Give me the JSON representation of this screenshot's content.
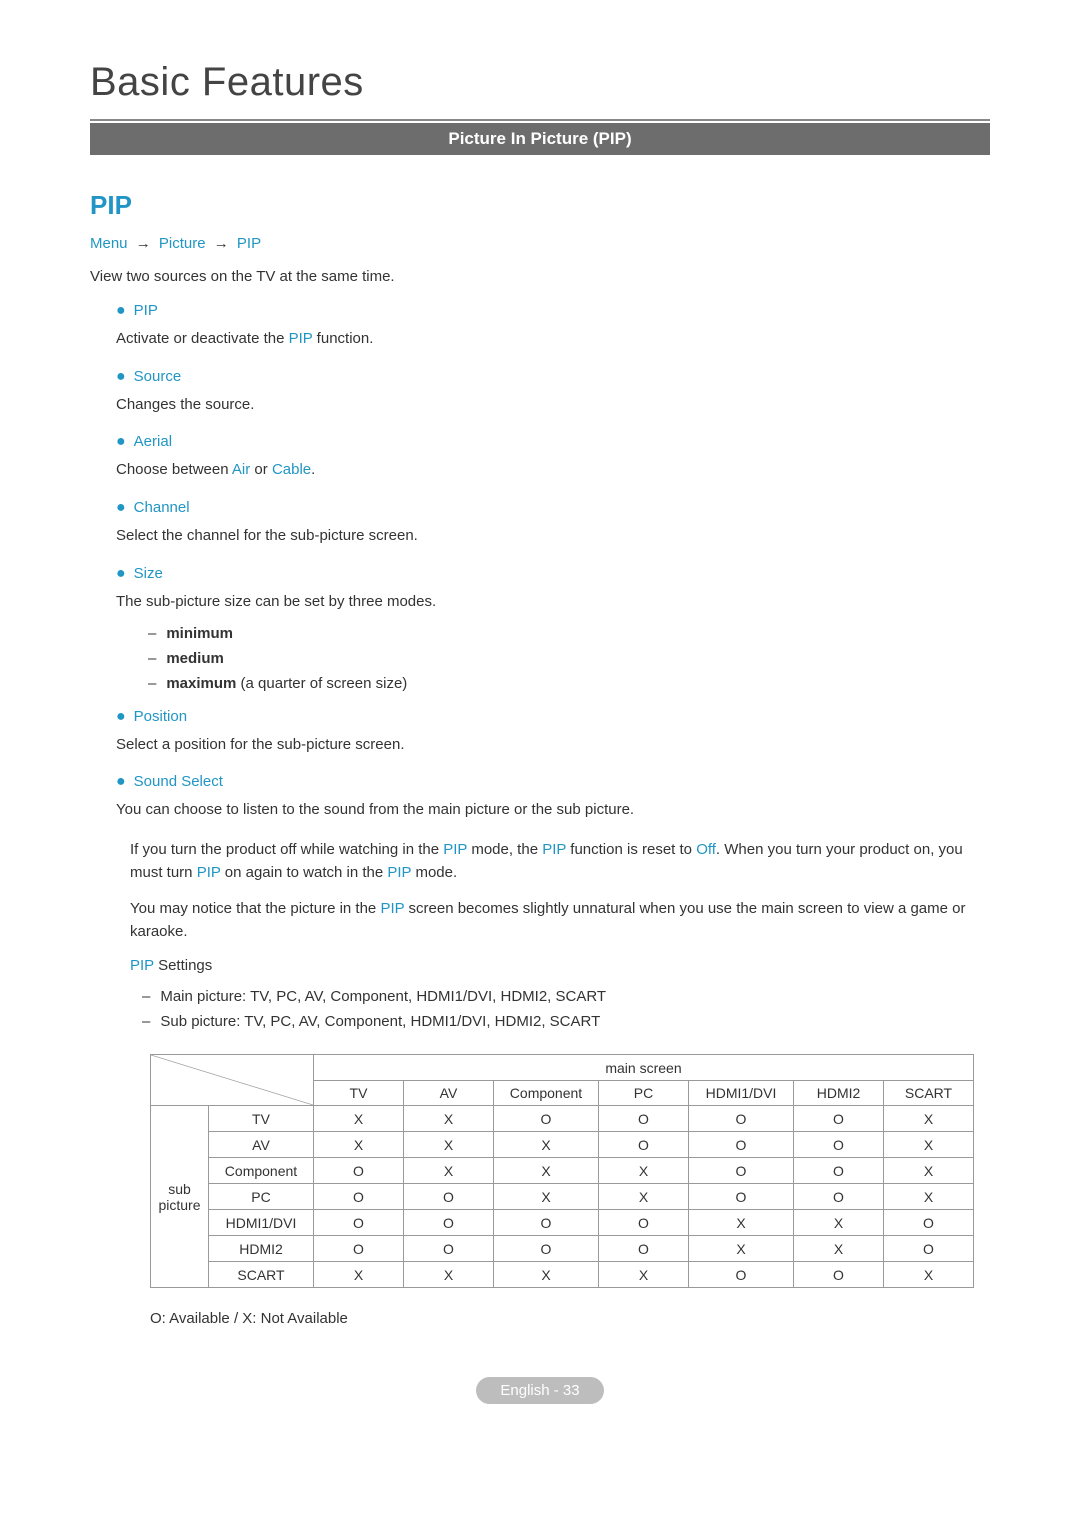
{
  "header": {
    "title": "Basic Features",
    "bar": "Picture In Picture (PIP)"
  },
  "section": {
    "h2": "PIP",
    "breadcrumb": {
      "a": "Menu",
      "b": "Picture",
      "c": "PIP",
      "arrow": "→"
    },
    "intro": "View two sources on the TV at the same time."
  },
  "features": {
    "pip": {
      "name": "PIP",
      "desc_pre": "Activate or deactivate the ",
      "desc_hl": "PIP",
      "desc_post": " function."
    },
    "source": {
      "name": "Source",
      "desc": "Changes the source."
    },
    "aerial": {
      "name": "Aerial",
      "desc_pre": "Choose between ",
      "hl1": "Air",
      "mid": " or ",
      "hl2": "Cable",
      "post": "."
    },
    "channel": {
      "name": "Channel",
      "desc": "Select the channel for the sub-picture screen."
    },
    "size": {
      "name": "Size",
      "desc": "The sub-picture size can be set by three modes.",
      "modes": {
        "m1": "minimum",
        "m2": "medium",
        "m3_b": "maximum",
        "m3_rest": " (a quarter of screen size)"
      }
    },
    "position": {
      "name": "Position",
      "desc": "Select a position for the sub-picture screen."
    },
    "sound": {
      "name": "Sound Select",
      "desc": "You can choose to listen to the sound from the main picture or the sub picture."
    }
  },
  "notes": {
    "n1_a": "If you turn the product off while watching in the ",
    "n1_b": "PIP",
    "n1_c": " mode, the ",
    "n1_d": "PIP",
    "n1_e": " function is reset to ",
    "n1_f": "Off",
    "n1_g": ". When you turn your product on, you must turn ",
    "n1_h": "PIP",
    "n1_i": " on again to watch in the ",
    "n1_j": "PIP",
    "n1_k": " mode.",
    "n2_a": "You may notice that the picture in the ",
    "n2_b": "PIP",
    "n2_c": " screen becomes slightly unnatural when you use the main screen to view a game or karaoke."
  },
  "settings": {
    "label_hl": "PIP",
    "label_rest": " Settings",
    "main": "Main picture: TV, PC, AV, Component, HDMI1/DVI, HDMI2, SCART",
    "sub": "Sub picture: TV, PC, AV, Component, HDMI1/DVI, HDMI2, SCART"
  },
  "table": {
    "main_header": "main screen",
    "side_header_1": "sub",
    "side_header_2": "picture",
    "cols": [
      "TV",
      "AV",
      "Component",
      "PC",
      "HDMI1/DVI",
      "HDMI2",
      "SCART"
    ],
    "rows": [
      {
        "name": "TV",
        "cells": [
          "X",
          "X",
          "O",
          "O",
          "O",
          "O",
          "X"
        ]
      },
      {
        "name": "AV",
        "cells": [
          "X",
          "X",
          "X",
          "O",
          "O",
          "O",
          "X"
        ]
      },
      {
        "name": "Component",
        "cells": [
          "O",
          "X",
          "X",
          "X",
          "O",
          "O",
          "X"
        ]
      },
      {
        "name": "PC",
        "cells": [
          "O",
          "O",
          "X",
          "X",
          "O",
          "O",
          "X"
        ]
      },
      {
        "name": "HDMI1/DVI",
        "cells": [
          "O",
          "O",
          "O",
          "O",
          "X",
          "X",
          "O"
        ]
      },
      {
        "name": "HDMI2",
        "cells": [
          "O",
          "O",
          "O",
          "O",
          "X",
          "X",
          "O"
        ]
      },
      {
        "name": "SCART",
        "cells": [
          "X",
          "X",
          "X",
          "X",
          "O",
          "O",
          "X"
        ]
      }
    ],
    "legend": "O: Available / X: Not Available"
  },
  "footer": {
    "lang": "English",
    "sep": " - ",
    "page": "33"
  }
}
